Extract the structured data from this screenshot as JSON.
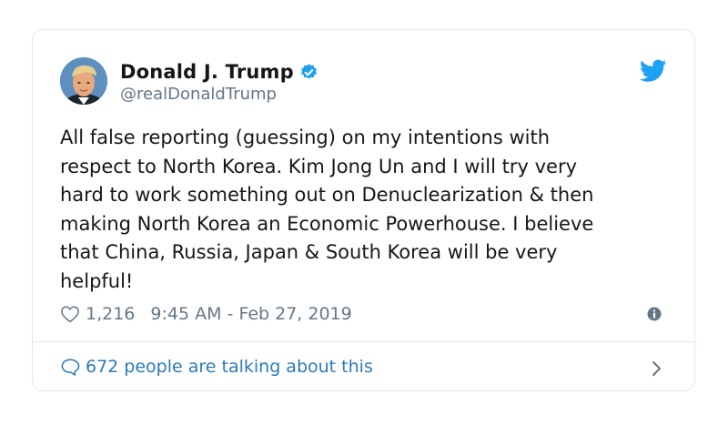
{
  "tweet": {
    "display_name": "Donald J. Trump",
    "handle": "@realDonaldTrump",
    "verified": true,
    "text": "All false reporting (guessing) on my intentions with\nrespect to North Korea. Kim Jong Un and I will try very\nhard to work something out on Denuclearization & then\nmaking North Korea an Economic Powerhouse. I believe\nthat China, Russia, Japan & South Korea will be very\nhelpful!",
    "likes": "1,216",
    "timestamp": "9:45 AM - Feb 27, 2019",
    "conversation_label": "672 people are talking about this"
  },
  "icons": {
    "avatar": "profile-photo",
    "verified": "verified-badge-icon",
    "brand": "twitter-bird-icon",
    "like": "heart-icon",
    "info": "info-icon",
    "reply": "reply-bubble-icon",
    "chevron": "chevron-right-icon"
  },
  "colors": {
    "brand": "#1da1f2",
    "link": "#2b7bb9",
    "muted": "#657786",
    "border": "#e1e8ed",
    "text": "#14171a"
  }
}
